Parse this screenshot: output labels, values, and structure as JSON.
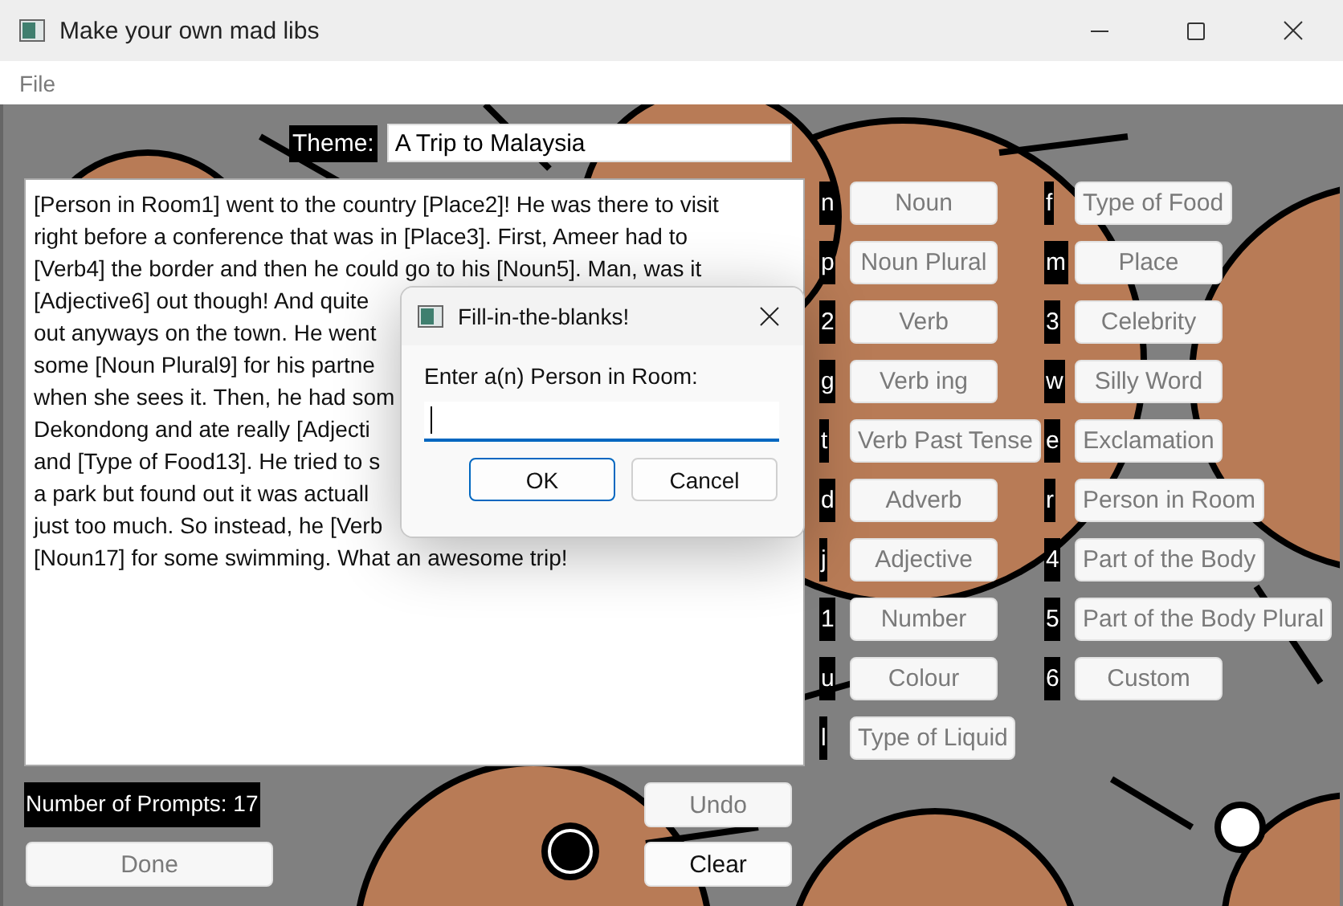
{
  "window": {
    "title": "Make your own mad libs"
  },
  "menu": [
    {
      "label": "File",
      "disabled": true
    }
  ],
  "theme": {
    "label": "Theme:",
    "value": "A Trip to Malaysia"
  },
  "story": {
    "lines": [
      "[Person in Room1] went to the country [Place2]! He was there to visit",
      "right before a conference that was in [Place3]. First, Ameer had to",
      "[Verb4] the border and then he could go to his [Noun5]. Man, was it",
      "[Adjective6] out though! And quite",
      "out anyways on the town. He went",
      "some [Noun Plural9] for his partne",
      "when she sees it. Then, he had som",
      "Dekondong and ate really [Adjecti",
      "and [Type of Food13]. He tried to s",
      "a park but found out it was actuall",
      "just too much. So instead, he [Verb",
      "[Noun17] for some swimming. What an awesome trip!"
    ]
  },
  "prompts": [
    {
      "key": "n",
      "label": "Noun",
      "disabled": true
    },
    {
      "key": "f",
      "label": "Type of Food",
      "disabled": true
    },
    {
      "key": "p",
      "label": "Noun Plural",
      "disabled": true
    },
    {
      "key": "m",
      "label": "Place",
      "disabled": true
    },
    {
      "key": "2",
      "label": "Verb",
      "disabled": true
    },
    {
      "key": "3",
      "label": "Celebrity",
      "disabled": true
    },
    {
      "key": "g",
      "label": "Verb ing",
      "disabled": true
    },
    {
      "key": "w",
      "label": "Silly Word",
      "disabled": true
    },
    {
      "key": "t",
      "label": "Verb Past Tense",
      "disabled": true
    },
    {
      "key": "e",
      "label": "Exclamation",
      "disabled": true
    },
    {
      "key": "d",
      "label": "Adverb",
      "disabled": true
    },
    {
      "key": "r",
      "label": "Person in Room",
      "disabled": true
    },
    {
      "key": "j",
      "label": "Adjective",
      "disabled": true
    },
    {
      "key": "4",
      "label": "Part of the Body",
      "disabled": true
    },
    {
      "key": "1",
      "label": "Number",
      "disabled": true
    },
    {
      "key": "5",
      "label": "Part of the Body Plural",
      "disabled": true
    },
    {
      "key": "u",
      "label": "Colour",
      "disabled": true
    },
    {
      "key": "6",
      "label": "Custom",
      "disabled": true
    },
    {
      "key": "l",
      "label": "Type of Liquid",
      "disabled": true
    }
  ],
  "prompt_count": "Number of Prompts: 17",
  "done_button": {
    "label": "Done",
    "disabled": true
  },
  "edit_buttons": [
    {
      "label": "Undo",
      "disabled": true
    },
    {
      "label": "Clear",
      "disabled": false
    }
  ],
  "dialog": {
    "title": "Fill-in-the-blanks!",
    "prompt": "Enter a(n) Person in Room:",
    "buttons": [
      {
        "label": "OK",
        "default": true
      },
      {
        "label": "Cancel",
        "default": false
      }
    ]
  }
}
